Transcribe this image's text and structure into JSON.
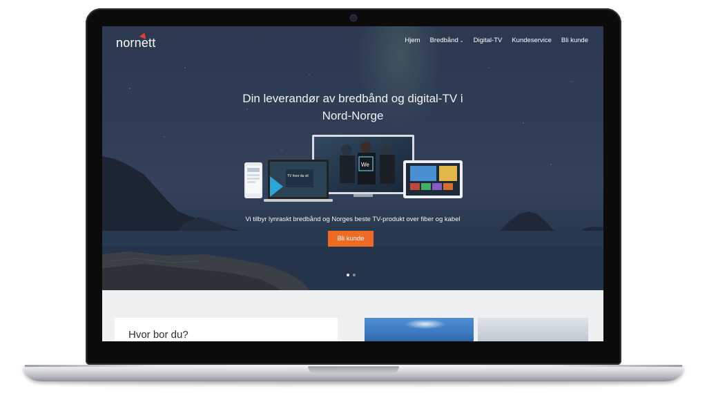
{
  "brand": {
    "name": "nornett",
    "accent": "#e63b2e"
  },
  "nav": {
    "items": [
      {
        "label": "Hjem"
      },
      {
        "label": "Bredbånd",
        "has_dropdown": true
      },
      {
        "label": "Digital-TV"
      },
      {
        "label": "Kundeservice"
      },
      {
        "label": "Bli kunde"
      }
    ]
  },
  "hero": {
    "headline_line1": "Din leverandør av bredbånd og digital-TV i",
    "headline_line2": "Nord-Norge",
    "subline": "Vi tilbyr lynraskt bredbånd og Norges beste TV-produkt over fiber og kabel",
    "cta_label": "Bli kunde",
    "cta_color": "#ef6a24",
    "device_screen_text": "TV hvor du vil",
    "tv_badge": "We",
    "carousel": {
      "slides": 2,
      "active": 1
    }
  },
  "lower": {
    "card_title": "Hvor bor du?"
  }
}
